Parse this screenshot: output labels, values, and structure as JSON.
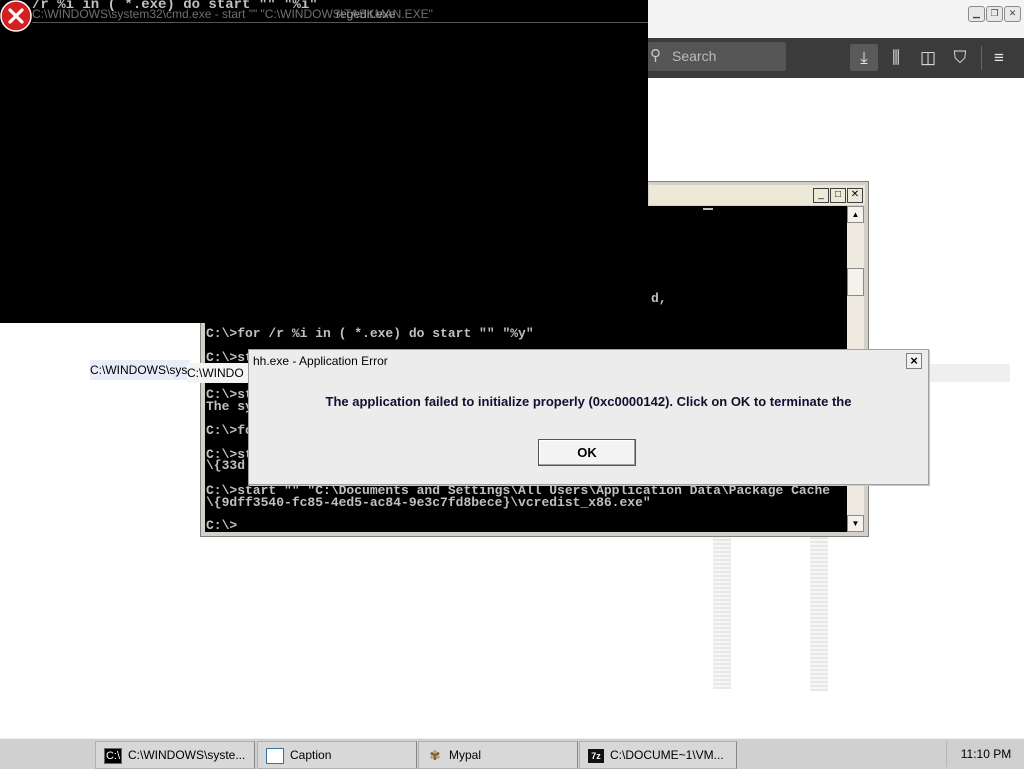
{
  "browser": {
    "search_placeholder": "Search",
    "window_controls": [
      "minimize",
      "restore",
      "close"
    ],
    "toolbar_icons": [
      "download-icon",
      "library-icon",
      "sidebar-icon",
      "ublock-icon",
      "menu-icon"
    ]
  },
  "top_console": {
    "command_line": "/r %i in ( *.exe) do start \"\" \"%i\"",
    "title_text": "C:\\WINDOWS\\system32\\cmd.exe - start \"\" \"C:\\WINDOWS\\TASKMAN.EXE\"",
    "title_overlay": "regedit.exe"
  },
  "cmd_window": {
    "lines": [
      "C:\\>for /r %i in ( *.exe) do start \"\" \"%y\"",
      "C:\\>st",
      "C:\\>st",
      "The sy",
      "C:\\>fo",
      "C:\\>st",
      "\\{33d",
      "C:\\>start \"\" \"C:\\Documents and Settings\\All Users\\Application Data\\Package Cache",
      "\\{9dff3540-fc85-4ed5-ac84-9e3c7fd8bece}\\vcredist_x86.exe\"",
      "C:\\>"
    ],
    "fragment_right": "d,"
  },
  "previews": {
    "p1": "C:\\WINDOWS\\sys",
    "p2": "C:\\WINDO"
  },
  "dialog": {
    "title": "hh.exe - Application Error",
    "message": "The application failed to initialize properly (0xc0000142). Click on OK to terminate the",
    "ok_label": "OK"
  },
  "taskbar": {
    "items": [
      {
        "label": "C:\\WINDOWS\\syste...",
        "icon": "cmd-icon"
      },
      {
        "label": "Caption",
        "icon": "window-icon"
      },
      {
        "label": "Mypal",
        "icon": "mypal-icon"
      },
      {
        "label": "C:\\DOCUME~1\\VM...",
        "icon": "7zip-icon"
      }
    ],
    "clock": "11:10 PM"
  },
  "colors": {
    "console_bg": "#000000",
    "console_text": "#c0c0c0",
    "error_red": "#d42020"
  }
}
